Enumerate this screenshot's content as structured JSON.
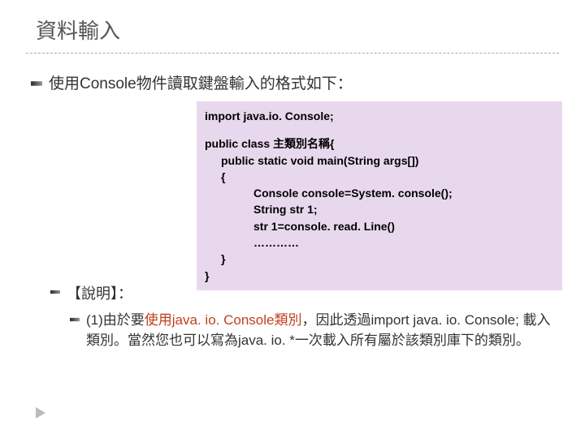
{
  "title": "資料輸入",
  "lead": "使用Console物件讀取鍵盤輸入的格式如下：",
  "code": {
    "l1": "import java.io. Console;",
    "l2": "public class 主類別名稱{",
    "l3": "public static void main(String args[])",
    "l4": "{",
    "l5": "Console console=System. console();",
    "l6": "String str 1;",
    "l7": "str 1=console. read. Line()",
    "l8": "…………",
    "l9": "}",
    "l10": "}"
  },
  "section_label": "【說明】：",
  "note": {
    "prefix": "(1)由於要",
    "highlight": "使用java. io. Console類別",
    "rest": "，因此透過import java. io. Console; 載入類別。當然您也可以寫為java. io. *一次載入所有屬於該類別庫下的類別。"
  }
}
